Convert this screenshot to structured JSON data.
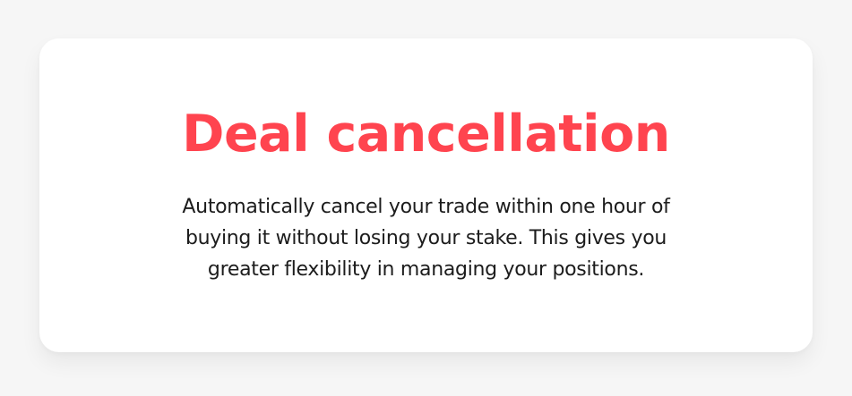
{
  "card": {
    "title": "Deal cancellation",
    "description_lines": [
      "Automatically cancel your trade within one hour of",
      "buying it without losing your stake. This gives you",
      "greater flexibility in managing your positions."
    ]
  },
  "colors": {
    "accent": "#ff444f",
    "text": "#1c1c1c",
    "card_background": "#ffffff",
    "page_background": "#f6f6f6"
  }
}
